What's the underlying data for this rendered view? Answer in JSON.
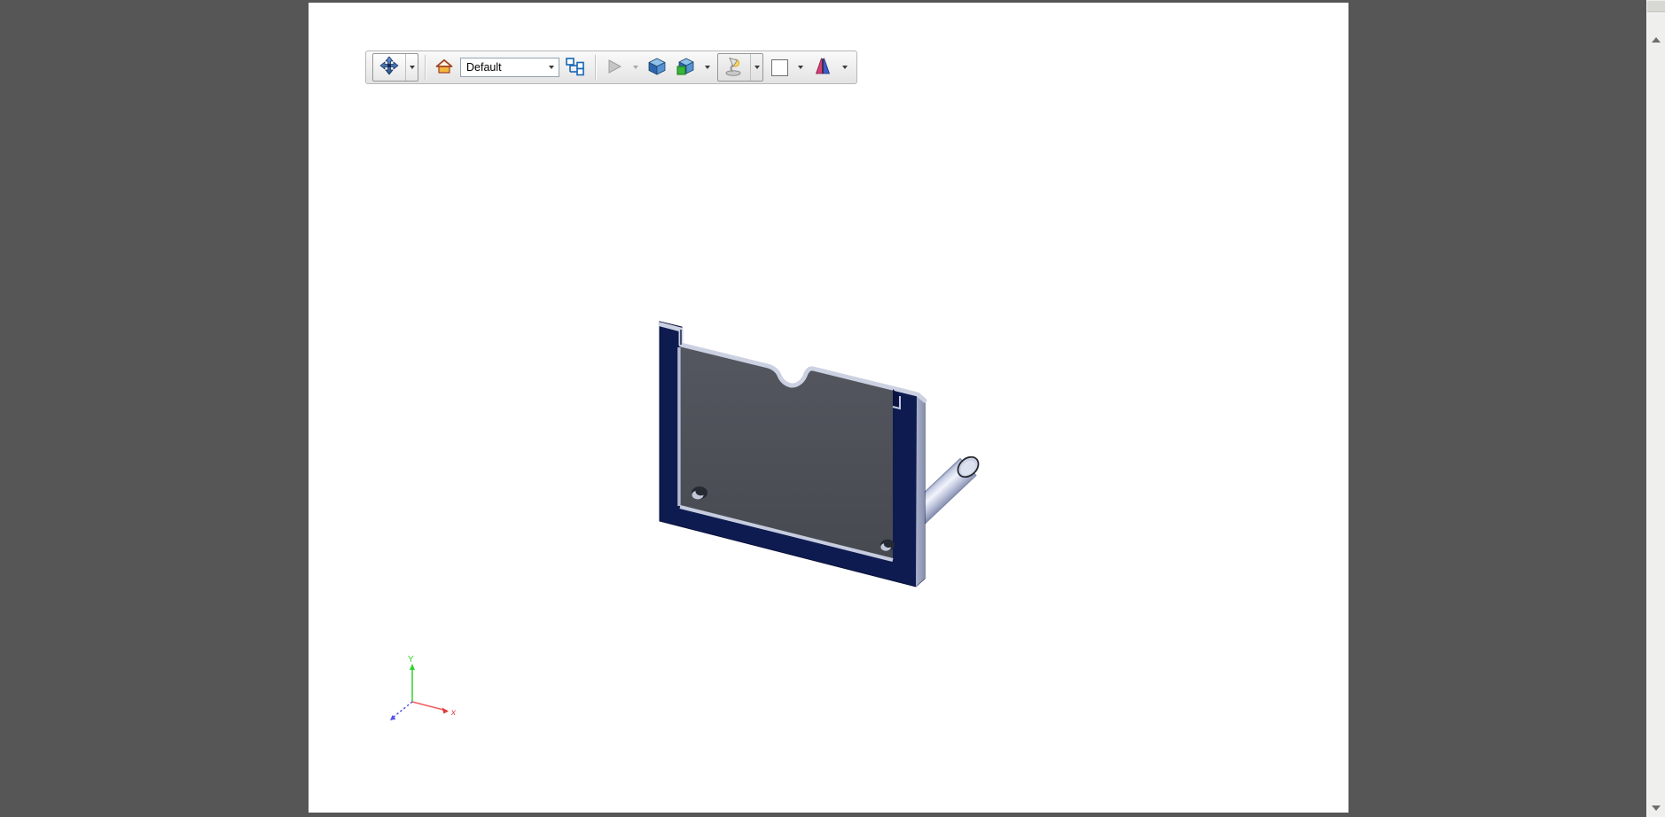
{
  "window": {
    "backdrop_color": "#565656",
    "canvas_color": "#ffffff"
  },
  "toolbar": {
    "config_dropdown": {
      "value": "Default"
    },
    "icons": [
      {
        "name": "pan-icon",
        "meaning": "pan/move view",
        "has_dropdown": true
      },
      {
        "name": "home-icon",
        "meaning": "home / default view"
      },
      {
        "name": "configuration-tree-icon",
        "meaning": "component tree"
      },
      {
        "name": "play-icon",
        "meaning": "play animation (disabled)",
        "has_dropdown": true
      },
      {
        "name": "shaded-cube-icon",
        "meaning": "shaded display mode"
      },
      {
        "name": "cube-green-face-icon",
        "meaning": "display mode options",
        "has_dropdown": true
      },
      {
        "name": "lamp-icon",
        "meaning": "lighting (toggled on)",
        "has_dropdown": true
      },
      {
        "name": "background-swatch-icon",
        "meaning": "background color",
        "has_dropdown": true
      },
      {
        "name": "cross-section-icon",
        "meaning": "cross section",
        "has_dropdown": true
      }
    ]
  },
  "viewport": {
    "triad": {
      "y_label": "Y",
      "x_label": "x"
    },
    "triad_colors": {
      "x": "#ee5555",
      "y": "#2fd32f",
      "z": "#5353e8"
    }
  },
  "model": {
    "description": "navy U-channel frame holding dark gray plate with notch, two holes, silver rod",
    "frame_color": "#0e1b50",
    "plate_color": "#4b4e59",
    "edge_color": "#ccd1e2",
    "rod_color": "#c9d0e4",
    "side_face_color": "#99a1bf"
  },
  "scrollbar": {
    "present": true
  }
}
